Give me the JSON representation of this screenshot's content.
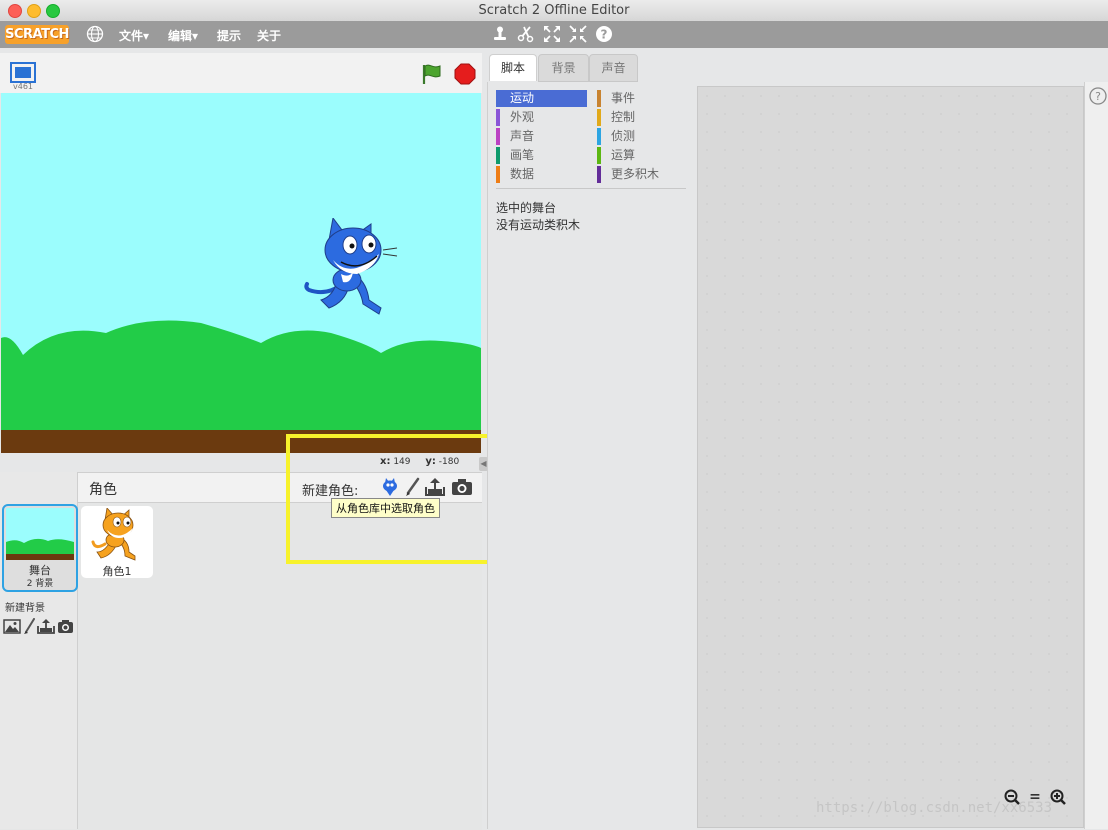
{
  "window": {
    "title": "Scratch 2 Offline Editor"
  },
  "menu": {
    "logo": "SCRATCH",
    "items": [
      "文件▾",
      "编辑▾",
      "提示",
      "关于"
    ]
  },
  "stage": {
    "version": "v461",
    "coords_x_label": "x:",
    "coords_x": "149",
    "coords_y_label": "y:",
    "coords_y": "-180"
  },
  "tabs": [
    "脚本",
    "背景",
    "声音"
  ],
  "palette": {
    "categories_left": [
      {
        "label": "运动",
        "color": "#4a6cd4"
      },
      {
        "label": "外观",
        "color": "#8a55d7"
      },
      {
        "label": "声音",
        "color": "#bb42c3"
      },
      {
        "label": "画笔",
        "color": "#0e9a6c"
      },
      {
        "label": "数据",
        "color": "#ee7d16"
      }
    ],
    "categories_right": [
      {
        "label": "事件",
        "color": "#c88330"
      },
      {
        "label": "控制",
        "color": "#e1a91a"
      },
      {
        "label": "侦测",
        "color": "#2ca5e2"
      },
      {
        "label": "运算",
        "color": "#5cb712"
      },
      {
        "label": "更多积木",
        "color": "#632d99"
      }
    ],
    "selected_stage_text": "选中的舞台",
    "no_blocks_text": "没有运动类积木"
  },
  "sprites": {
    "header": "角色",
    "new_sprite_label": "新建角色:",
    "tooltip": "从角色库中选取角色",
    "stage_name": "舞台",
    "stage_backdrops": "2 背景",
    "new_backdrop_label": "新建背景",
    "items": [
      {
        "name": "角色1"
      }
    ]
  },
  "zoom": {
    "out": "−",
    "reset": "=",
    "in": "+"
  },
  "watermark": "https://blog.csdn.net/xx6533",
  "colors": {
    "selected_border": "#2ea2e3",
    "highlight": "#f7f22b",
    "stage_sky": "#9bfdfd",
    "hills": "#22cc48",
    "ground": "#6b3a0f"
  }
}
